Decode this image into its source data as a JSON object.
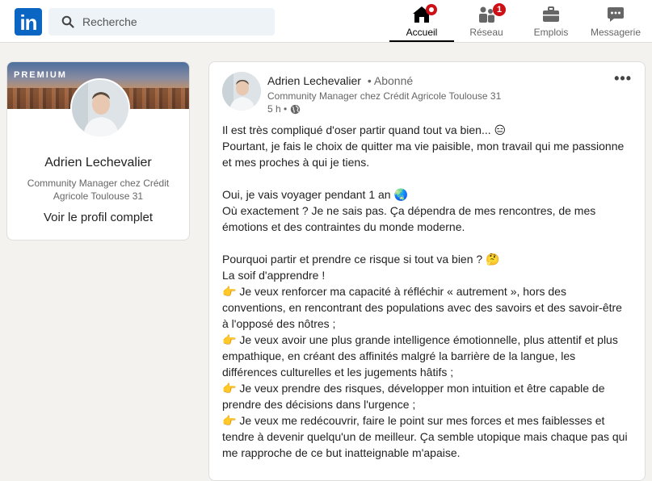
{
  "nav": {
    "logo": "in",
    "search_placeholder": "Recherche",
    "items": [
      {
        "label": "Accueil",
        "icon": "home-icon",
        "active": true,
        "badge": ""
      },
      {
        "label": "Réseau",
        "icon": "network-icon",
        "active": false,
        "badge": "1"
      },
      {
        "label": "Emplois",
        "icon": "briefcase-icon",
        "active": false,
        "badge": ""
      },
      {
        "label": "Messagerie",
        "icon": "messaging-icon",
        "active": false,
        "badge": ""
      }
    ]
  },
  "profile": {
    "premium_label": "PREMIUM",
    "name": "Adrien Lechevalier",
    "headline": "Community Manager chez Crédit Agricole Toulouse 31",
    "view_profile": "Voir le profil complet"
  },
  "post": {
    "author": "Adrien Lechevalier",
    "separator": "•",
    "follow_status": "Abonné",
    "headline": "Community Manager chez Crédit Agricole Toulouse 31",
    "time": "5 h •",
    "more": "•••",
    "lines": [
      "Il est très compliqué d'oser partir quand tout va bien... 😑",
      "Pourtant, je fais le choix de quitter ma vie paisible, mon travail qui me passionne et mes proches à qui je tiens.",
      "",
      "Oui, je vais voyager pendant 1 an 🌏",
      "Où exactement ? Je ne sais pas. Ça dépendra de mes rencontres, de mes émotions et des contraintes du monde moderne.",
      "",
      "Pourquoi partir et prendre ce risque si tout va bien ? 🤔",
      "La soif d'apprendre !",
      "👉 Je veux renforcer ma capacité à réfléchir « autrement », hors des conventions, en rencontrant des populations avec des savoirs et des savoir-être à l'opposé des nôtres ;",
      "👉 Je veux avoir une plus grande intelligence émotionnelle, plus attentif et plus empathique, en créant des affinités malgré la barrière de la langue, les différences culturelles et les jugements hâtifs ;",
      "👉 Je veux prendre des risques, développer mon intuition et être capable de prendre des décisions dans l'urgence ;",
      "👉 Je veux me redécouvrir, faire le point sur mes forces et mes faiblesses et tendre à devenir quelqu'un de meilleur. Ça semble utopique mais chaque pas qui me rapproche de ce but inatteignable m'apaise."
    ]
  },
  "colors": {
    "brand": "#0a66c2",
    "badge": "#cc1016",
    "background": "#f3f2ef"
  }
}
